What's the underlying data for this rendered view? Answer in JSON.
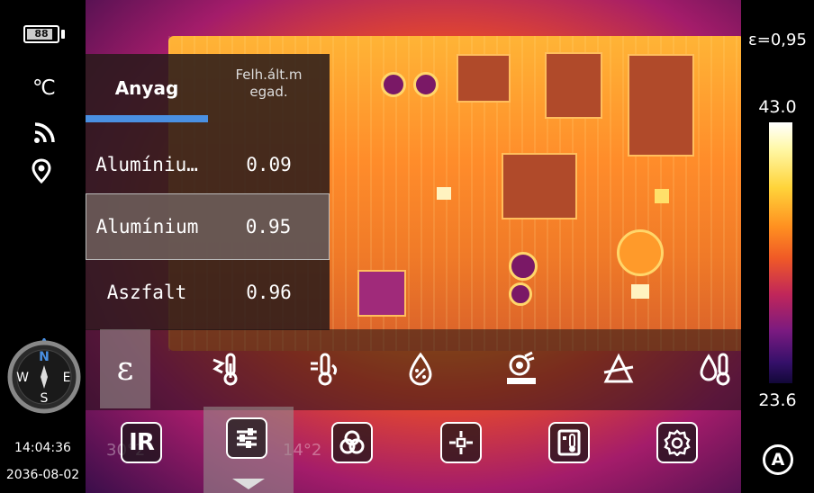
{
  "status": {
    "battery_level": "88",
    "battery_fraction": 0.88,
    "temperature_unit": "℃",
    "time": "14:04:36",
    "date": "2036-08-02",
    "compass": {
      "north": "N",
      "south": "S",
      "east": "E",
      "west": "W"
    }
  },
  "emissivity_table": {
    "tabs": [
      {
        "label": "Anyag",
        "active": true
      },
      {
        "label": "Felh.ált.m egad.",
        "line1": "Felh.ált.m",
        "line2": "egad.",
        "active": false
      }
    ],
    "rows": [
      {
        "name": "Alumíniu…",
        "value": "0.09",
        "selected": false
      },
      {
        "name": "Alumínium",
        "value": "0.95",
        "selected": true
      },
      {
        "name": "Aszfalt",
        "value": "0.96",
        "selected": false
      }
    ]
  },
  "tools": [
    {
      "icon": "emissivity-icon",
      "glyph": "ε",
      "active": true
    },
    {
      "icon": "reflected-temperature-icon"
    },
    {
      "icon": "ambient-temperature-icon"
    },
    {
      "icon": "humidity-icon"
    },
    {
      "icon": "distance-icon"
    },
    {
      "icon": "transmission-icon"
    },
    {
      "icon": "temperature-compensation-icon"
    }
  ],
  "bottom_buttons": [
    {
      "icon": "ir-mode-icon",
      "label": "IR"
    },
    {
      "icon": "parameter-settings-icon",
      "active": true
    },
    {
      "icon": "palette-icon"
    },
    {
      "icon": "measurement-point-icon"
    },
    {
      "icon": "alarm-temperature-icon"
    },
    {
      "icon": "gear-icon"
    }
  ],
  "ghost_text": {
    "left": "30°2",
    "right": "14°2"
  },
  "colors": {
    "accent": "#4a90e2"
  },
  "color_scale": {
    "emissivity": "ε=0,95",
    "max": "43.0",
    "min": "23.6",
    "auto_label": "A"
  }
}
